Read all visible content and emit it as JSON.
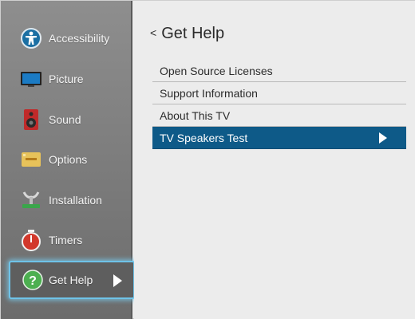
{
  "sidebar": {
    "items": [
      {
        "label": "Accessibility",
        "icon": "accessibility-icon"
      },
      {
        "label": "Picture",
        "icon": "picture-icon"
      },
      {
        "label": "Sound",
        "icon": "speaker-icon"
      },
      {
        "label": "Options",
        "icon": "options-icon"
      },
      {
        "label": "Installation",
        "icon": "satellite-icon"
      },
      {
        "label": "Timers",
        "icon": "timer-icon"
      },
      {
        "label": "Get Help",
        "icon": "help-icon",
        "selected": true
      }
    ]
  },
  "main": {
    "back_glyph": "<",
    "title": "Get Help",
    "menu": [
      {
        "label": "Open Source Licenses"
      },
      {
        "label": "Support Information"
      },
      {
        "label": "About This TV"
      },
      {
        "label": "TV Speakers Test",
        "selected": true
      }
    ]
  },
  "colors": {
    "sidebar_bg": "#7f7f7f",
    "selected_outline": "#6fc3e8",
    "menu_highlight": "#0e5a88",
    "panel_bg": "#ececec"
  }
}
